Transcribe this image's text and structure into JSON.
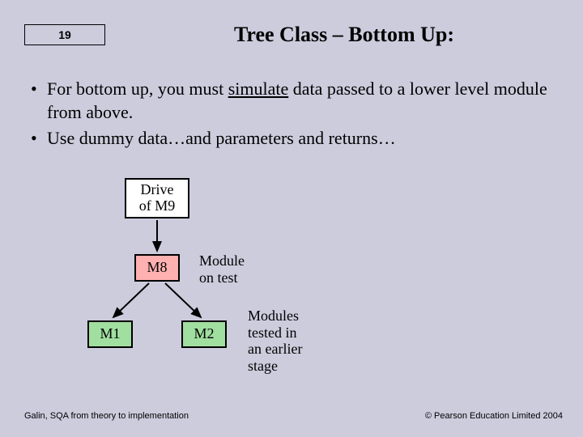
{
  "slide_number": "19",
  "title": "Tree Class – Bottom Up:",
  "bullets": {
    "b1_pre": "For bottom up, you must ",
    "b1_underline": "simulate",
    "b1_post": " data passed to a lower level module from above.",
    "b2": "Use dummy data…and parameters and returns…"
  },
  "diagram": {
    "top_line1": "Drive",
    "top_line2": "of M9",
    "mid": "M8",
    "left": "M1",
    "right": "M2",
    "label_mid_l1": "Module",
    "label_mid_l2": "on test",
    "label_bot_l1": "Modules",
    "label_bot_l2": "tested in",
    "label_bot_l3": "an earlier",
    "label_bot_l4": "stage"
  },
  "footer": {
    "left": "Galin, SQA from theory to implementation",
    "right": "© Pearson Education Limited 2004"
  }
}
